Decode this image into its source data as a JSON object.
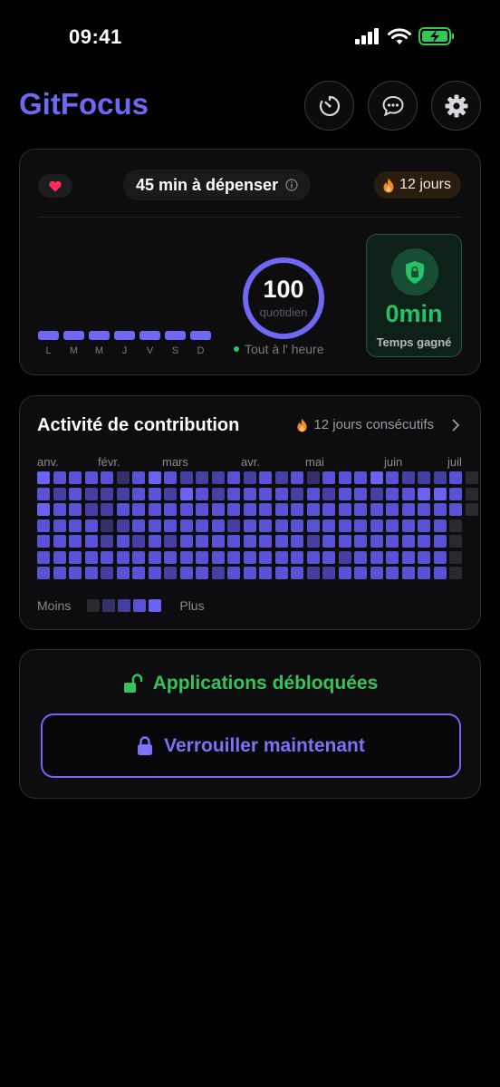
{
  "status_bar": {
    "time": "09:41"
  },
  "header": {
    "title": "GitFocus"
  },
  "summary": {
    "budget_label": "45 min à dépenser",
    "streak_label": "12 jours",
    "weekday_labels": [
      "L",
      "M",
      "M",
      "J",
      "V",
      "S",
      "D"
    ],
    "score_value": "100",
    "score_sublabel": "quotidien",
    "on_time_label": "Tout à l' heure",
    "time_saved_value": "0min",
    "time_saved_label": "Temps gagné"
  },
  "contributions": {
    "title": "Activité de contribution",
    "streak_label": "12 jours consécutifs",
    "months": [
      "anv.",
      "févr.",
      "mars",
      "avr.",
      "mai",
      "juin",
      "juil"
    ],
    "legend_less": "Moins",
    "legend_more": "Plus",
    "level_colors": [
      "#2a2a2e",
      "#34306a",
      "#463fa3",
      "#5a52d6",
      "#6a62f2"
    ],
    "weeks": [
      [
        4,
        3,
        4,
        3,
        3,
        3,
        3
      ],
      [
        3,
        2,
        3,
        3,
        3,
        3,
        3
      ],
      [
        3,
        3,
        3,
        3,
        3,
        3,
        3
      ],
      [
        3,
        2,
        2,
        3,
        3,
        3,
        3
      ],
      [
        3,
        2,
        2,
        1,
        2,
        3,
        2
      ],
      [
        1,
        2,
        3,
        2,
        3,
        3,
        3
      ],
      [
        3,
        3,
        3,
        3,
        2,
        3,
        3
      ],
      [
        4,
        3,
        3,
        3,
        3,
        3,
        3
      ],
      [
        3,
        2,
        3,
        3,
        2,
        3,
        2
      ],
      [
        2,
        4,
        3,
        3,
        3,
        3,
        3
      ],
      [
        2,
        3,
        3,
        3,
        3,
        3,
        3
      ],
      [
        2,
        2,
        3,
        3,
        3,
        3,
        2
      ],
      [
        3,
        3,
        3,
        2,
        3,
        3,
        3
      ],
      [
        2,
        3,
        3,
        3,
        3,
        3,
        3
      ],
      [
        3,
        3,
        3,
        3,
        3,
        3,
        3
      ],
      [
        2,
        3,
        3,
        3,
        3,
        3,
        3
      ],
      [
        3,
        2,
        3,
        3,
        3,
        3,
        3
      ],
      [
        1,
        3,
        3,
        3,
        2,
        3,
        2
      ],
      [
        3,
        2,
        3,
        3,
        3,
        3,
        2
      ],
      [
        3,
        3,
        3,
        3,
        3,
        2,
        3
      ],
      [
        3,
        3,
        3,
        3,
        3,
        3,
        3
      ],
      [
        4,
        2,
        3,
        3,
        3,
        3,
        3
      ],
      [
        3,
        3,
        3,
        3,
        3,
        3,
        3
      ],
      [
        2,
        3,
        3,
        3,
        3,
        3,
        3
      ],
      [
        2,
        4,
        3,
        3,
        3,
        3,
        3
      ],
      [
        2,
        4,
        3,
        3,
        3,
        3,
        3
      ],
      [
        3,
        3,
        3,
        0,
        0,
        0,
        0
      ],
      [
        0,
        0,
        0,
        null,
        null,
        null,
        null
      ]
    ]
  },
  "apps": {
    "unlocked_label": "Applications débloquées",
    "lock_button_label": "Verrouiller maintenant"
  },
  "colors": {
    "accent": "#6f68f5",
    "success": "#27c267",
    "streak": "#f28a2a",
    "heart": "#ff2d55"
  }
}
